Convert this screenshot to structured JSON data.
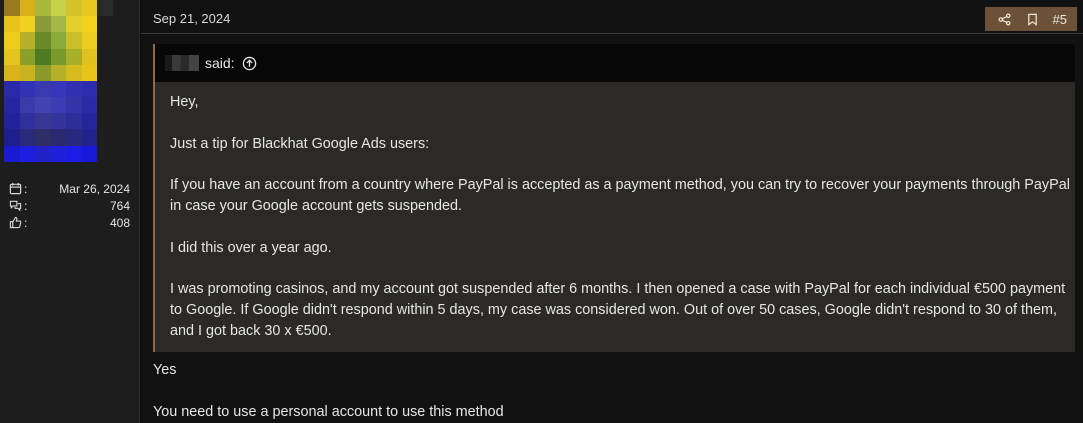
{
  "author": {
    "stats": [
      {
        "icon": "calendar-icon",
        "value": "Mar 26, 2024"
      },
      {
        "icon": "messages-icon",
        "value": "764"
      },
      {
        "icon": "thumbs-up-icon",
        "value": "408"
      }
    ]
  },
  "post": {
    "date": "Sep 21, 2024",
    "number": "#5",
    "actions": [
      "share-icon",
      "bookmark-icon"
    ],
    "accent_color": "#6b5138",
    "quote": {
      "said_label": "said:",
      "paragraphs": [
        "Hey,",
        "Just a tip for Blackhat Google Ads users:",
        "If you have an account from a country where PayPal is accepted as a payment method, you can try to recover your payments through PayPal in case your Google account gets suspended.",
        "I did this over a year ago.",
        "I was promoting casinos, and my account got suspended after 6 months. I then opened a case with PayPal for each individual €500 payment to Google. If Google didn't respond within 5 days, my case was considered won. Out of over 50 cases, Google didn't respond to 30 of them, and I got back 30 x €500."
      ]
    },
    "reply": [
      "Yes",
      "You need to use a personal account to use this method"
    ]
  }
}
